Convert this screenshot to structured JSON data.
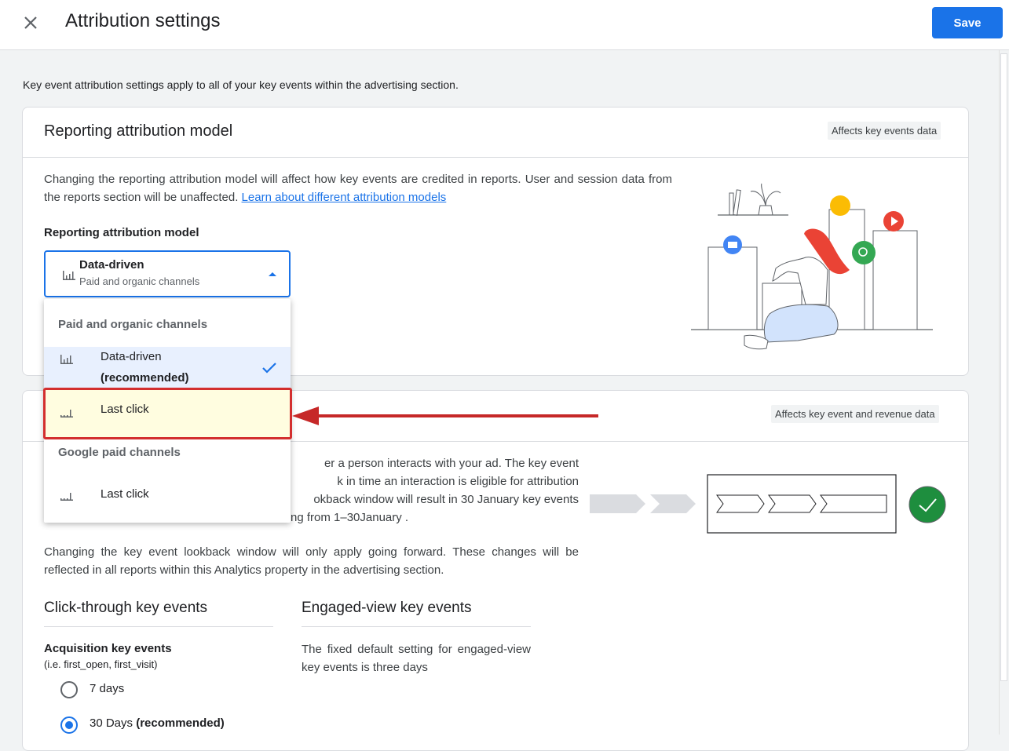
{
  "header": {
    "title": "Attribution settings",
    "save_label": "Save"
  },
  "intro": "Key event attribution settings apply to all of your key events within the advertising section.",
  "reporting": {
    "title": "Reporting attribution model",
    "chip": "Affects key events data",
    "desc": "Changing the reporting attribution model will affect how key events are credited in reports. User and session data from the reports section will be unaffected.",
    "link": "Learn about different attribution models",
    "field_label": "Reporting attribution model",
    "selected_main": "Data-driven",
    "selected_sub": "Paid and organic channels"
  },
  "dropdown": {
    "group1": "Paid and organic channels",
    "item1_line1": "Data-driven",
    "item1_line2": "(recommended)",
    "item2": "Last click",
    "group2": "Google paid channels",
    "item3": "Last click"
  },
  "lookback": {
    "chip": "Affects key event and revenue data",
    "partial_l1": "er a person interacts with your ad. The key event",
    "partial_l2": "k in time an interaction is eligible for attribution",
    "partial_l3": "okback window will result in 30 January key events",
    "partial_l4": "ng from 1–30January .",
    "forward": "Changing the key event lookback window will only apply going forward. These changes will be reflected in all reports within this Analytics property in the advertising section.",
    "click_through_title": "Click-through key events",
    "engaged_title": "Engaged-view key events",
    "acq_label": "Acquisition key events",
    "acq_example": "(i.e. first_open, first_visit)",
    "option_7": "7 days",
    "option_30": "30 Days",
    "option_30_suffix": "(recommended)",
    "engaged_desc": "The fixed default setting for engaged-view key events is three days"
  },
  "colors": {
    "accent": "#1a73e8",
    "highlight_border": "#d32f2f",
    "highlight_fill": "#fffde0",
    "check_green": "#1e8e3e"
  }
}
